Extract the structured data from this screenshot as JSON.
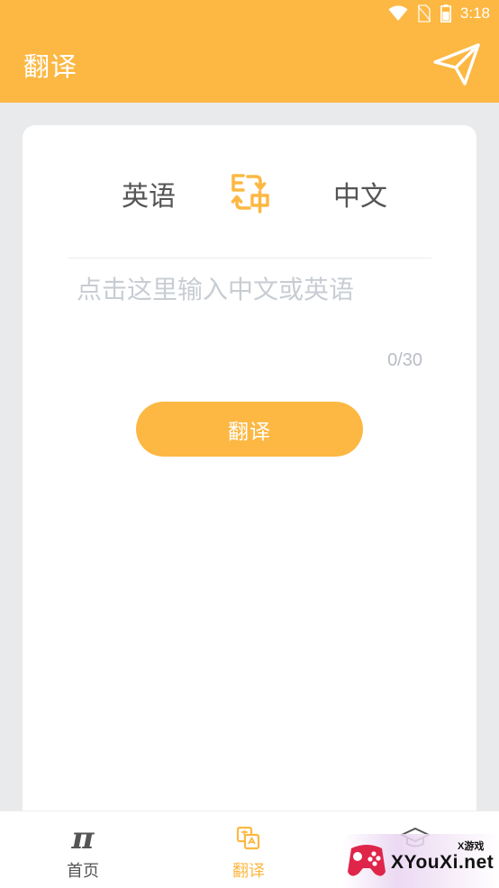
{
  "status_bar": {
    "time": "3:18",
    "icons": [
      "wifi-icon",
      "sim-off-icon",
      "battery-icon"
    ]
  },
  "app_bar": {
    "title": "翻译",
    "action_icon": "send-icon"
  },
  "translator": {
    "source_language": "英语",
    "target_language": "中文",
    "swap_icon": "swap-language-icon",
    "input_placeholder": "点击这里输入中文或英语",
    "input_value": "",
    "char_counter": "0/30",
    "translate_button": "翻译"
  },
  "bottom_nav": {
    "items": [
      {
        "label": "首页",
        "icon": "pi-icon",
        "active": false
      },
      {
        "label": "翻译",
        "icon": "translate-icon",
        "active": true
      },
      {
        "label": "",
        "icon": "graduation-cap-icon",
        "active": false
      }
    ]
  },
  "watermark": {
    "text": "XYouXi.net",
    "small_text": "X游戏"
  },
  "colors": {
    "accent": "#fcb843",
    "background": "#e9eaec",
    "card": "#ffffff",
    "text_dark": "#555555",
    "placeholder": "#c8cdd3"
  }
}
